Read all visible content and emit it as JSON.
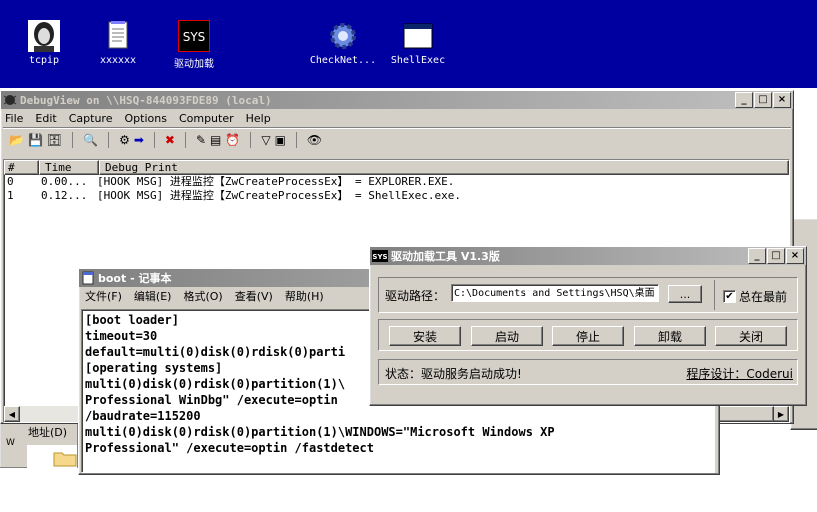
{
  "desktop": {
    "icons": [
      {
        "label": "tcpip",
        "icon": "portrait-icon"
      },
      {
        "label": "xxxxxx",
        "icon": "text-file-icon"
      },
      {
        "label": "驱动加载",
        "icon": "sys-icon"
      },
      {
        "label": "CheckNet...",
        "icon": "gear-icon"
      },
      {
        "label": "ShellExec",
        "icon": "window-icon"
      }
    ]
  },
  "debugview": {
    "title": "DebugView on \\\\HSQ-844093FDE89 (local)",
    "menu": [
      "File",
      "Edit",
      "Capture",
      "Options",
      "Computer",
      "Help"
    ],
    "columns": [
      "#",
      "Time",
      "Debug Print"
    ],
    "rows": [
      {
        "num": "0",
        "time": "0.00...",
        "print": "[HOOK MSG] 进程监控【ZwCreateProcessEx】 = EXPLORER.EXE."
      },
      {
        "num": "1",
        "time": "0.12...",
        "print": "[HOOK MSG] 进程监控【ZwCreateProcessEx】 = ShellExec.exe."
      }
    ]
  },
  "notepad": {
    "title": "boot - 记事本",
    "menu": [
      "文件(F)",
      "编辑(E)",
      "格式(O)",
      "查看(V)",
      "帮助(H)"
    ],
    "lines": [
      "[boot loader]",
      "timeout=30",
      "default=multi(0)disk(0)rdisk(0)parti",
      "[operating systems]",
      "multi(0)disk(0)rdisk(0)partition(1)\\",
      "Professional WinDbg\" /execute=optin",
      "/baudrate=115200",
      "multi(0)disk(0)rdisk(0)partition(1)\\WINDOWS=\"Microsoft Windows XP",
      "Professional\" /execute=optin /fastdetect"
    ]
  },
  "explorer": {
    "address_label": "地址(D)",
    "side_letter": "W"
  },
  "loader": {
    "title": "驱动加载工具 V1.3版",
    "path_label": "驱动路径：",
    "path_value": "C:\\Documents and Settings\\HSQ\\桌面",
    "browse": "...",
    "topmost_label": "总在最前",
    "buttons": [
      "安装",
      "启动",
      "停止",
      "卸载",
      "关闭"
    ],
    "status": "状态：驱动服务启动成功!",
    "credit": "程序设计：Coderui"
  }
}
